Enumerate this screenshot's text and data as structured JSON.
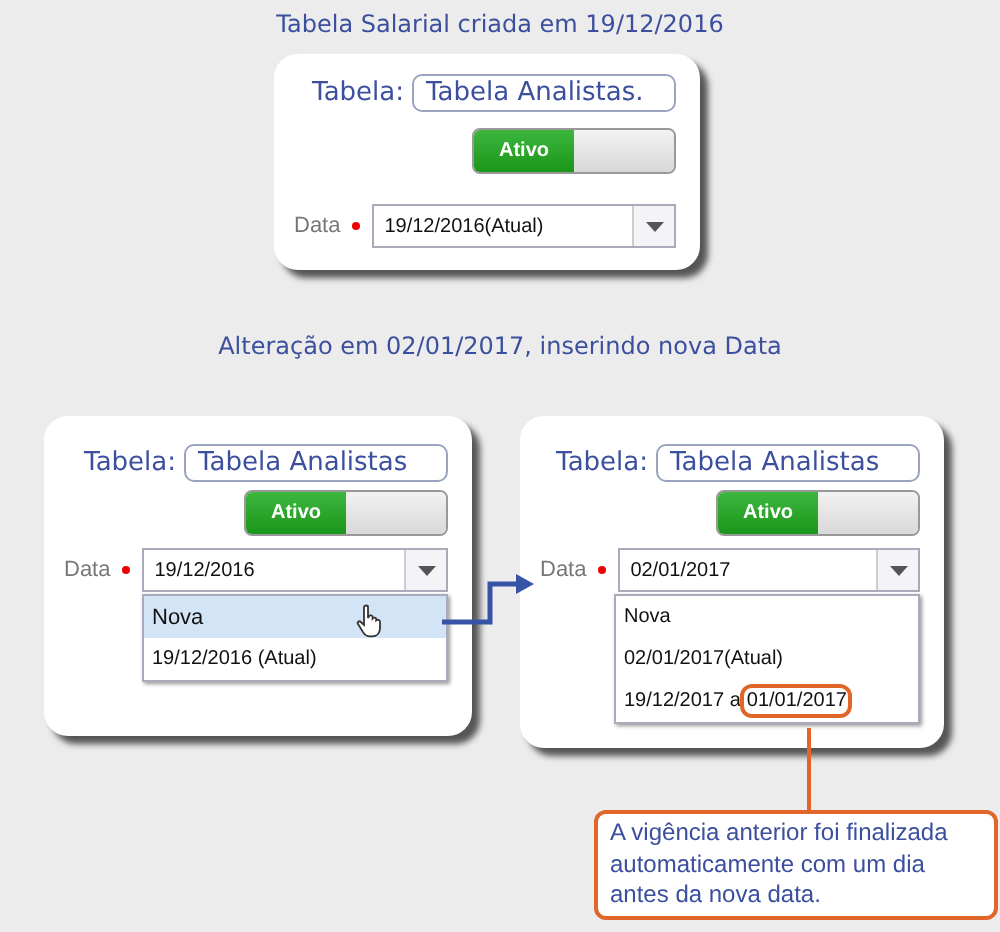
{
  "sections": [
    {
      "heading": "Tabela Salarial criada em 19/12/2016",
      "cards": [
        {
          "table_label": "Tabela:",
          "table_value": "Tabela Analistas.",
          "toggle": {
            "label": "Ativo",
            "on": true
          },
          "date_label": "Data",
          "date_value": "19/12/2016(Atual)"
        }
      ]
    },
    {
      "heading": "Alteração em 02/01/2017, inserindo nova Data",
      "cards": [
        {
          "table_label": "Tabela:",
          "table_value": "Tabela Analistas",
          "toggle": {
            "label": "Ativo",
            "on": true
          },
          "date_label": "Data",
          "date_value": "19/12/2016",
          "options": [
            {
              "text": "Nova",
              "selected": true
            },
            {
              "text": "19/12/2016 (Atual)",
              "selected": false
            }
          ]
        },
        {
          "table_label": "Tabela:",
          "table_value": "Tabela Analistas",
          "toggle": {
            "label": "Ativo",
            "on": true
          },
          "date_label": "Data",
          "date_value": "02/01/2017",
          "options": [
            {
              "text": "Nova",
              "selected": false
            },
            {
              "text": "02/01/2017(Atual)",
              "selected": false
            },
            {
              "text": "19/12/2017 a",
              "highlight": "01/01/2017",
              "selected": false
            }
          ]
        }
      ]
    }
  ],
  "callout": "A vigência anterior foi finalizada automaticamente com um dia antes da nova data."
}
